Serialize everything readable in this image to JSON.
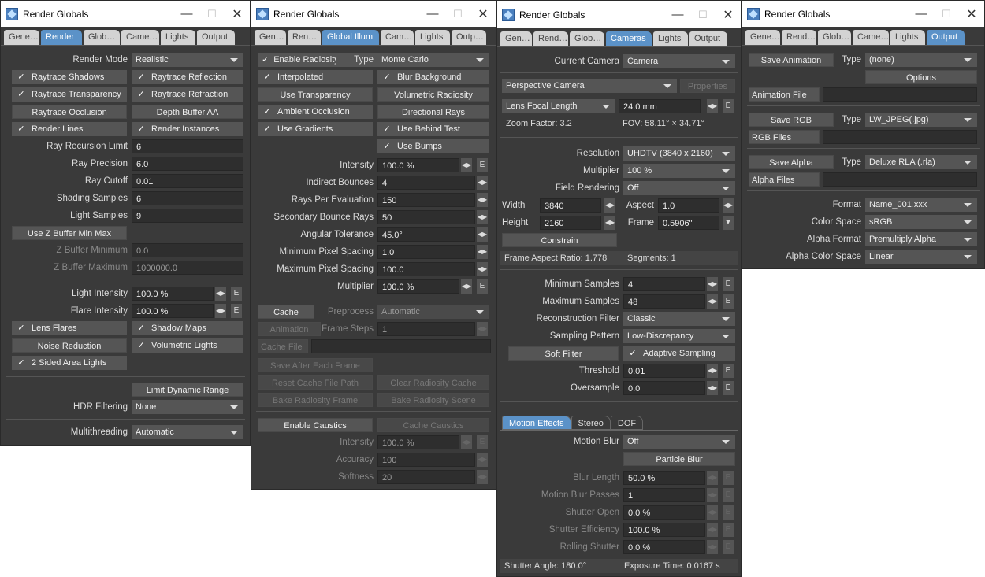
{
  "window_title": "Render Globals",
  "titlebar": {
    "minimize": "—",
    "maximize": "☐",
    "close": "✕"
  },
  "w1": {
    "tabs": [
      "Gene…",
      "Render",
      "Glob…",
      "Came…",
      "Lights",
      "Output"
    ],
    "active_tab": 1,
    "render_mode_label": "Render Mode",
    "render_mode_value": "Realistic",
    "raytrace_shadows": "Raytrace Shadows",
    "raytrace_reflection": "Raytrace Reflection",
    "raytrace_transparency": "Raytrace Transparency",
    "raytrace_refraction": "Raytrace Refraction",
    "raytrace_occlusion": "Raytrace Occlusion",
    "depth_buffer_aa": "Depth Buffer AA",
    "render_lines": "Render Lines",
    "render_instances": "Render Instances",
    "ray_recursion_limit_label": "Ray Recursion Limit",
    "ray_recursion_limit": "6",
    "ray_precision_label": "Ray Precision",
    "ray_precision": "6.0",
    "ray_cutoff_label": "Ray Cutoff",
    "ray_cutoff": "0.01",
    "shading_samples_label": "Shading Samples",
    "shading_samples": "6",
    "light_samples_label": "Light Samples",
    "light_samples": "9",
    "use_zbuffer": "Use Z Buffer Min Max",
    "zbuffer_min_label": "Z Buffer Minimum",
    "zbuffer_min": "0.0",
    "zbuffer_max_label": "Z Buffer Maximum",
    "zbuffer_max": "1000000.0",
    "light_intensity_label": "Light Intensity",
    "light_intensity": "100.0 %",
    "flare_intensity_label": "Flare Intensity",
    "flare_intensity": "100.0 %",
    "lens_flares": "Lens Flares",
    "shadow_maps": "Shadow Maps",
    "noise_reduction": "Noise Reduction",
    "volumetric_lights": "Volumetric Lights",
    "two_sided": "2 Sided Area Lights",
    "limit_dynamic_range": "Limit Dynamic Range",
    "hdr_filtering_label": "HDR Filtering",
    "hdr_filtering": "None",
    "multithreading_label": "Multithreading",
    "multithreading": "Automatic"
  },
  "w2": {
    "tabs": [
      "Gen…",
      "Ren…",
      "Global Illum",
      "Cam…",
      "Lights",
      "Outp…"
    ],
    "active_tab": 2,
    "enable_radiosity": "Enable Radiosity",
    "type_label": "Type",
    "type_value": "Monte Carlo",
    "interpolated": "Interpolated",
    "blur_background": "Blur Background",
    "use_transparency": "Use Transparency",
    "volumetric_radiosity": "Volumetric Radiosity",
    "ambient_occlusion": "Ambient Occlusion",
    "directional_rays": "Directional Rays",
    "use_gradients": "Use Gradients",
    "use_behind_test": "Use Behind Test",
    "use_bumps": "Use Bumps",
    "intensity_label": "Intensity",
    "intensity": "100.0 %",
    "indirect_bounces_label": "Indirect Bounces",
    "indirect_bounces": "4",
    "rays_per_eval_label": "Rays Per Evaluation",
    "rays_per_eval": "150",
    "secondary_rays_label": "Secondary Bounce Rays",
    "secondary_rays": "50",
    "angular_tolerance_label": "Angular Tolerance",
    "angular_tolerance": "45.0°",
    "min_pixel_spacing_label": "Minimum Pixel Spacing",
    "min_pixel_spacing": "1.0",
    "max_pixel_spacing_label": "Maximum Pixel Spacing",
    "max_pixel_spacing": "100.0",
    "multiplier_label": "Multiplier",
    "multiplier": "100.0 %",
    "cache": "Cache",
    "preprocess_label": "Preprocess",
    "preprocess": "Automatic",
    "animation": "Animation",
    "frame_steps_label": "Frame Steps",
    "frame_steps": "1",
    "cache_file": "Cache File",
    "save_after_each_frame": "Save After Each Frame",
    "reset_cache_path": "Reset Cache File Path",
    "clear_cache": "Clear Radiosity Cache",
    "bake_frame": "Bake Radiosity Frame",
    "bake_scene": "Bake Radiosity Scene",
    "enable_caustics": "Enable Caustics",
    "cache_caustics": "Cache Caustics",
    "c_intensity_label": "Intensity",
    "c_intensity": "100.0 %",
    "accuracy_label": "Accuracy",
    "accuracy": "100",
    "softness_label": "Softness",
    "softness": "20"
  },
  "w3": {
    "tabs": [
      "Gen…",
      "Rend…",
      "Glob…",
      "Cameras",
      "Lights",
      "Output"
    ],
    "active_tab": 3,
    "current_camera_label": "Current Camera",
    "current_camera": "Camera",
    "camera_type": "Perspective Camera",
    "properties": "Properties",
    "lens_focal_label": "Lens Focal Length",
    "lens_focal": "24.0 mm",
    "zoom_factor": "Zoom Factor: 3.2",
    "fov": "FOV: 58.11° × 34.71°",
    "resolution_label": "Resolution",
    "resolution": "UHDTV (3840 x 2160)",
    "multiplier_label": "Multiplier",
    "multiplier": "100 %",
    "field_rendering_label": "Field Rendering",
    "field_rendering": "Off",
    "width_label": "Width",
    "width": "3840",
    "aspect_label": "Aspect",
    "aspect": "1.0",
    "height_label": "Height",
    "height": "2160",
    "frame_label": "Frame",
    "frame": "0.5906\"",
    "constrain": "Constrain",
    "frame_aspect": "Frame Aspect Ratio: 1.778",
    "segments": "Segments: 1",
    "min_samples_label": "Minimum Samples",
    "min_samples": "4",
    "max_samples_label": "Maximum Samples",
    "max_samples": "48",
    "recon_filter_label": "Reconstruction Filter",
    "recon_filter": "Classic",
    "sampling_pattern_label": "Sampling Pattern",
    "sampling_pattern": "Low-Discrepancy",
    "soft_filter": "Soft Filter",
    "adaptive_sampling": "Adaptive Sampling",
    "threshold_label": "Threshold",
    "threshold": "0.01",
    "oversample_label": "Oversample",
    "oversample": "0.0",
    "subtabs": [
      "Motion Effects",
      "Stereo",
      "DOF"
    ],
    "motion_blur_label": "Motion Blur",
    "motion_blur": "Off",
    "particle_blur": "Particle Blur",
    "blur_length_label": "Blur Length",
    "blur_length": "50.0 %",
    "mb_passes_label": "Motion Blur Passes",
    "mb_passes": "1",
    "shutter_open_label": "Shutter Open",
    "shutter_open": "0.0 %",
    "shutter_eff_label": "Shutter Efficiency",
    "shutter_eff": "100.0 %",
    "rolling_shutter_label": "Rolling Shutter",
    "rolling_shutter": "0.0 %",
    "shutter_angle": "Shutter Angle: 180.0°",
    "exposure_time": "Exposure Time: 0.0167 s"
  },
  "w4": {
    "tabs": [
      "Gene…",
      "Rend…",
      "Glob…",
      "Came…",
      "Lights",
      "Output"
    ],
    "active_tab": 5,
    "save_animation": "Save Animation",
    "type_label": "Type",
    "anim_type": "(none)",
    "options": "Options",
    "animation_file": "Animation File",
    "save_rgb": "Save RGB",
    "rgb_type": "LW_JPEG(.jpg)",
    "rgb_files": "RGB Files",
    "save_alpha": "Save Alpha",
    "alpha_type": "Deluxe RLA (.rla)",
    "alpha_files": "Alpha Files",
    "format_label": "Format",
    "format": "Name_001.xxx",
    "color_space_label": "Color Space",
    "color_space": "sRGB",
    "alpha_format_label": "Alpha Format",
    "alpha_format": "Premultiply Alpha",
    "alpha_cs_label": "Alpha Color Space",
    "alpha_cs": "Linear"
  }
}
